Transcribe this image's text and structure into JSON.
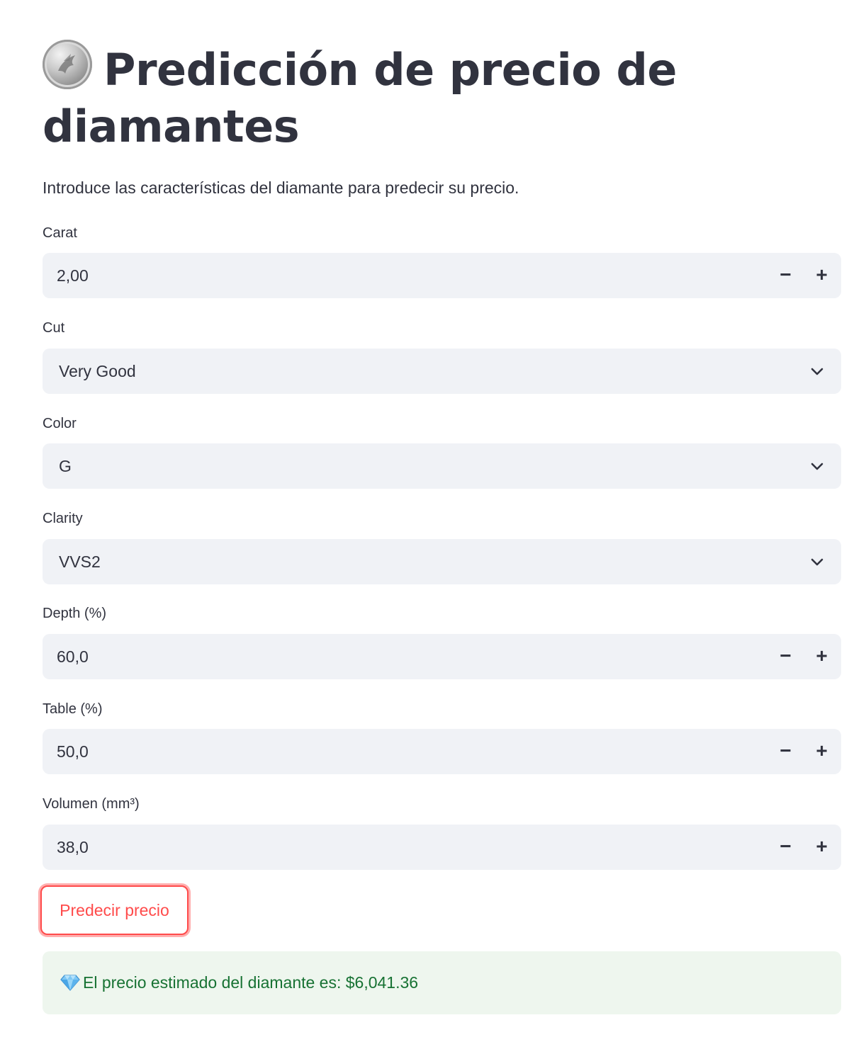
{
  "header": {
    "title": "Predicción de precio de diamantes",
    "subtitle": "Introduce las características del diamante para predecir su precio."
  },
  "fields": {
    "carat": {
      "label": "Carat",
      "value": "2,00",
      "minus": "−",
      "plus": "+"
    },
    "cut": {
      "label": "Cut",
      "value": "Very Good"
    },
    "color": {
      "label": "Color",
      "value": "G"
    },
    "clarity": {
      "label": "Clarity",
      "value": "VVS2"
    },
    "depth": {
      "label": "Depth (%)",
      "value": "60,0",
      "minus": "−",
      "plus": "+"
    },
    "table": {
      "label": "Table (%)",
      "value": "50,0",
      "minus": "−",
      "plus": "+"
    },
    "volume": {
      "label": "Volumen (mm³)",
      "value": "38,0",
      "minus": "−",
      "plus": "+"
    }
  },
  "actions": {
    "predict_label": "Predecir precio"
  },
  "result": {
    "text": "El precio estimado del diamante es: $6,041.36"
  },
  "icons": {
    "title_icon": "coin-icon",
    "result_icon": "gem-icon",
    "select_icon": "chevron-down-icon"
  },
  "colors": {
    "primary": "#ff4b4b",
    "text": "#31333f",
    "input_bg": "#f0f2f6",
    "success_bg": "#eef6ee",
    "success_text": "#177233"
  }
}
